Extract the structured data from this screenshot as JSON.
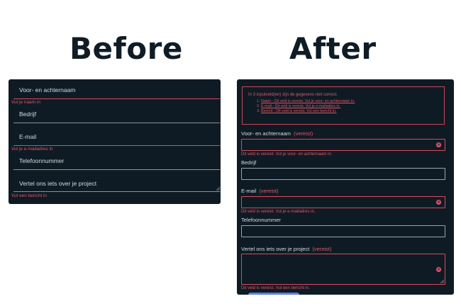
{
  "titles": {
    "before": "Before",
    "after": "After"
  },
  "before": {
    "fields": [
      {
        "label": "Voor- en achternaam",
        "error": "Vul je naam in"
      },
      {
        "label": "Bedrijf",
        "error": ""
      },
      {
        "label": "E-mail",
        "error": "Vul je e-mailadres in"
      },
      {
        "label": "Telefoonnummer",
        "error": ""
      },
      {
        "label": "Vertel ons iets over je project",
        "error": "Vul een bericht in"
      }
    ]
  },
  "after": {
    "summary": {
      "intro": "In 3 inputveld(en) zijn de gegevens niet correct.",
      "items": [
        "Naam - Dit veld is vereist. Vul je voor- en achternaam in.",
        "E-mail - Dit veld is vereist. Vul je e-mailadres in.",
        "Bericht - Dit veld is vereist. Vul een bericht in."
      ]
    },
    "required_marker": "(vereist)",
    "fields": [
      {
        "label": "Voor- en achternaam",
        "error": "Dit veld is vereist. Vul je voor- en achternaam in."
      },
      {
        "label": "Bedrijf",
        "error": ""
      },
      {
        "label": "E-mail",
        "error": "Dit veld is vereist. Vul je e-mailadres in."
      },
      {
        "label": "Telefoonnummer",
        "error": ""
      },
      {
        "label": "Vertel ons iets over je project",
        "error": "Dit veld is vereist. Vul een bericht in."
      }
    ],
    "error_icon": "×"
  },
  "colors": {
    "panel": "#0f1b24",
    "error": "#e0566a",
    "title": "#0f1c26"
  }
}
